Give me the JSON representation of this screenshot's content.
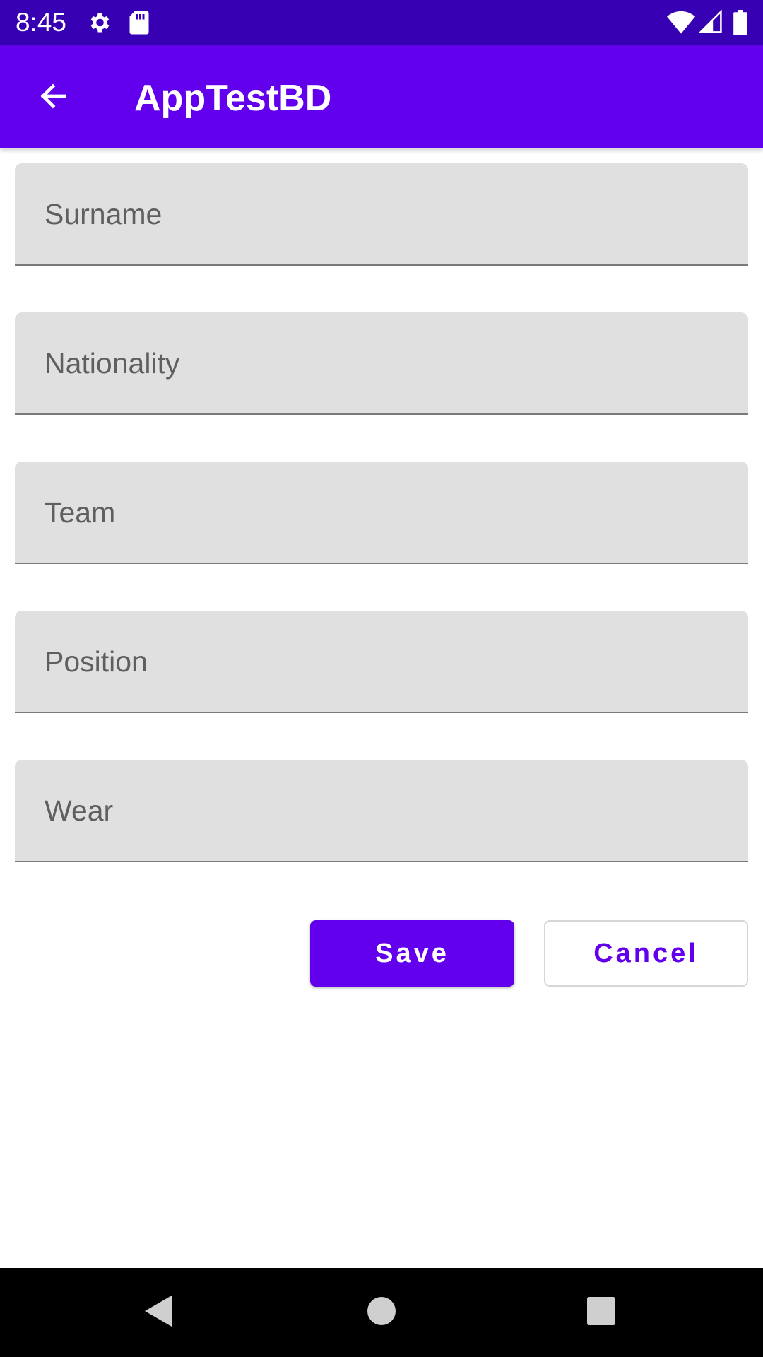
{
  "status_bar": {
    "time": "8:45",
    "icons": [
      "gear-icon",
      "sd-card-icon",
      "wifi-icon",
      "signal-icon",
      "battery-icon"
    ]
  },
  "app_bar": {
    "title": "AppTestBD",
    "back_icon": "arrow-back-icon",
    "color": "#6200ee"
  },
  "form": {
    "fields": [
      {
        "label": "Surname",
        "value": ""
      },
      {
        "label": "Nationality",
        "value": ""
      },
      {
        "label": "Team",
        "value": ""
      },
      {
        "label": "Position",
        "value": ""
      },
      {
        "label": "Wear",
        "value": ""
      }
    ],
    "save_label": "Save",
    "cancel_label": "Cancel"
  },
  "nav_bar": {
    "icons": [
      "back-triangle-icon",
      "home-circle-icon",
      "recents-square-icon"
    ]
  },
  "colors": {
    "primary": "#6200ee",
    "primary_dark": "#3700b3",
    "field_bg": "#e0e0e0"
  }
}
